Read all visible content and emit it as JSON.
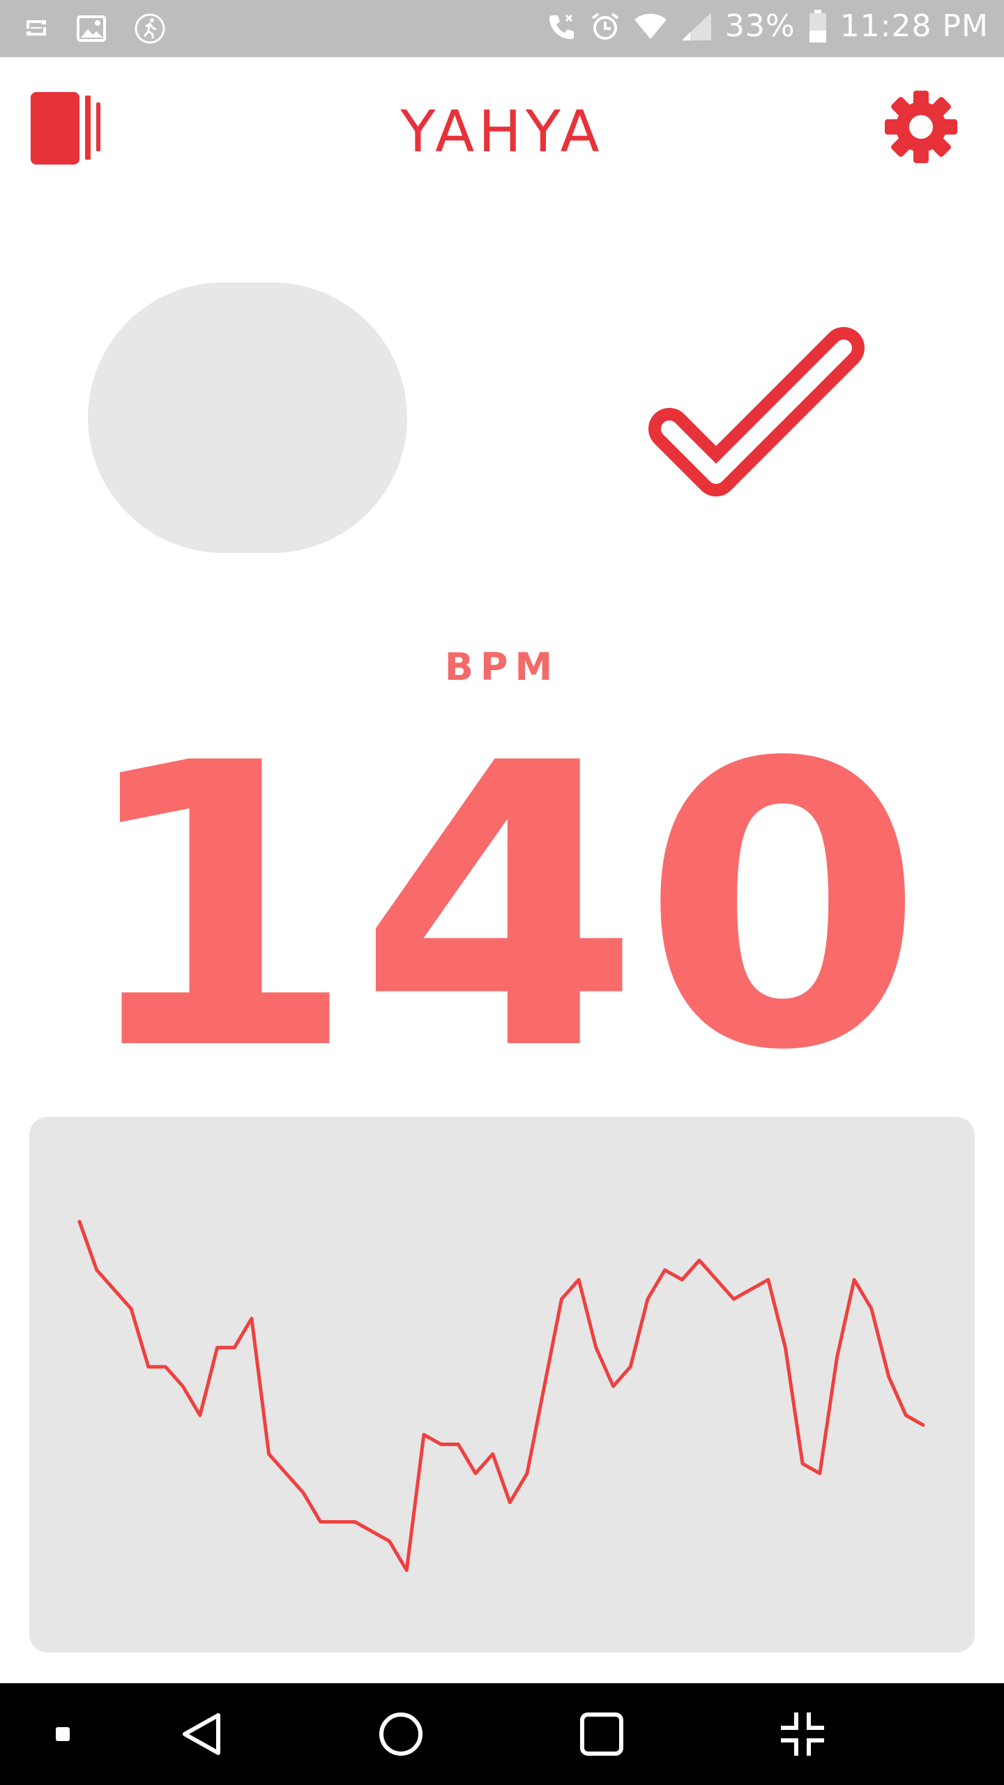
{
  "status_bar": {
    "battery": "33%",
    "time": "11:28 PM",
    "left_icons": [
      "cast-icon",
      "image-icon",
      "running-icon"
    ],
    "right_icons": [
      "call-icon",
      "alarm-icon",
      "wifi-icon",
      "signal-icon",
      "battery-icon"
    ]
  },
  "header": {
    "title": "YAHYA",
    "menu_icon": "cards-icon",
    "settings_icon": "gear-icon"
  },
  "status": {
    "indicator_icon": "checkmark-icon"
  },
  "heart_rate": {
    "label": "BPM",
    "value": "140"
  },
  "colors": {
    "accent": "#e8323a",
    "value": "#f96a6a",
    "chart_line": "#ef4040",
    "card_bg": "#e6e6e6"
  },
  "chart_data": {
    "type": "line",
    "series": [
      {
        "values": [
          110,
          105,
          103,
          101,
          95,
          95,
          93,
          90,
          97,
          97,
          100,
          86,
          84,
          82,
          79,
          79,
          79,
          78,
          77,
          74,
          88,
          87,
          87,
          84,
          86,
          81,
          84,
          93,
          102,
          104,
          97,
          93,
          95,
          102,
          105,
          104,
          106,
          104,
          102,
          103,
          104,
          97,
          85,
          84,
          96,
          104,
          101,
          94,
          90,
          89
        ]
      }
    ]
  },
  "nav_bar": {
    "buttons": [
      "menu-dot-icon",
      "back-icon",
      "home-icon",
      "recents-icon",
      "collapse-icon"
    ]
  }
}
